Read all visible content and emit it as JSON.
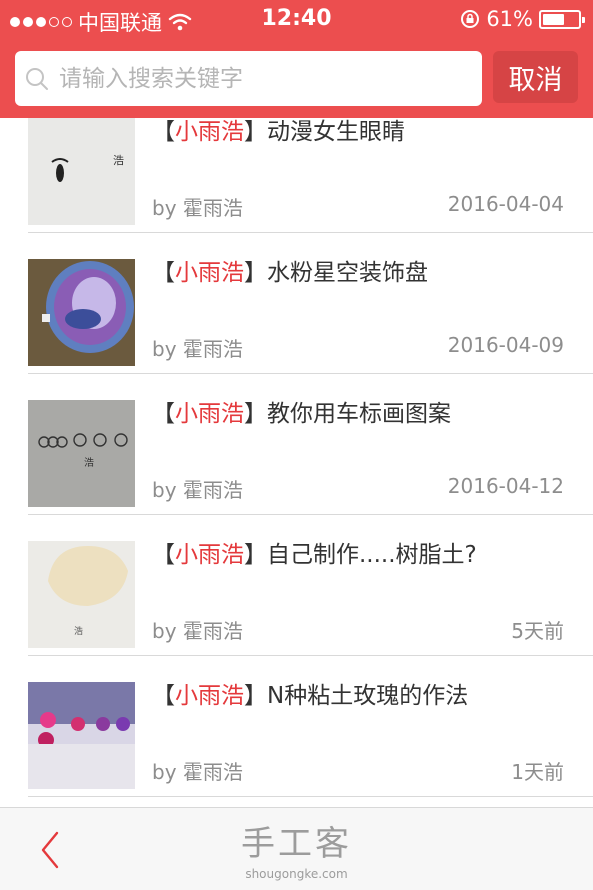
{
  "status_bar": {
    "carrier": "中国联通",
    "time": "12:40",
    "battery": "61%",
    "battery_level": 0.61
  },
  "search": {
    "placeholder": "请输入搜索关键字",
    "value": "",
    "cancel_label": "取消"
  },
  "items": [
    {
      "bracket_open": "【",
      "author_tag": "小雨浩",
      "bracket_close": "】",
      "title": "动漫女生眼睛",
      "by": "by 霍雨浩",
      "date": "2016-04-04"
    },
    {
      "bracket_open": "【",
      "author_tag": "小雨浩",
      "bracket_close": "】",
      "title": "水粉星空装饰盘",
      "by": "by 霍雨浩",
      "date": "2016-04-09"
    },
    {
      "bracket_open": "【",
      "author_tag": "小雨浩",
      "bracket_close": "】",
      "title": "教你用车标画图案",
      "by": "by 霍雨浩",
      "date": "2016-04-12"
    },
    {
      "bracket_open": "【",
      "author_tag": "小雨浩",
      "bracket_close": "】",
      "title": "自己制作.....树脂土?",
      "by": "by 霍雨浩",
      "date": "5天前"
    },
    {
      "bracket_open": "【",
      "author_tag": "小雨浩",
      "bracket_close": "】",
      "title": "N种粘土玫瑰的作法",
      "by": "by 霍雨浩",
      "date": "1天前"
    }
  ],
  "footer": {
    "brand": "手工客",
    "domain": "shougongke.com"
  },
  "colors": {
    "accent": "#ec4e4f",
    "author": "#e4393c"
  }
}
